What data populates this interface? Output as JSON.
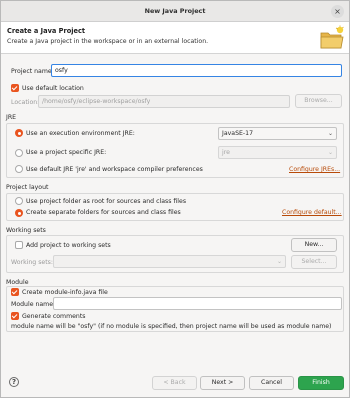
{
  "window": {
    "title": "New Java Project",
    "close_glyph": "×"
  },
  "banner": {
    "heading": "Create a Java Project",
    "description": "Create a Java project in the workspace or in an external location."
  },
  "project": {
    "name_label": "Project name:",
    "name_value": "osfy"
  },
  "location": {
    "use_default_label": "Use default location",
    "use_default_checked": true,
    "label": "Location:",
    "value": "/home/osfy/eclipse-workspace/osfy",
    "browse_label": "Browse..."
  },
  "jre": {
    "title": "JRE",
    "exec_env_label": "Use an execution environment JRE:",
    "exec_env_value": "JavaSE-17",
    "specific_label": "Use a project specific JRE:",
    "specific_value": "jre",
    "default_label": "Use default JRE 'jre' and workspace compiler preferences",
    "configure_link": "Configure JREs...",
    "selected": "exec_env"
  },
  "layout": {
    "title": "Project layout",
    "root_label": "Use project folder as root for sources and class files",
    "separate_label": "Create separate folders for sources and class files",
    "configure_link": "Configure default...",
    "selected": "separate"
  },
  "working_sets": {
    "title": "Working sets",
    "add_label": "Add project to working sets",
    "new_button": "New...",
    "sets_label": "Working sets:",
    "select_button": "Select..."
  },
  "module": {
    "title": "Module",
    "create_label": "Create module-info.java file",
    "name_label": "Module name:",
    "name_value": "",
    "comments_label": "Generate comments",
    "note": "module name will be \"osfy\"  (if no module is specified, then project name will be used as module name)"
  },
  "footer": {
    "help_glyph": "?",
    "back": "< Back",
    "next": "Next >",
    "cancel": "Cancel",
    "finish": "Finish"
  },
  "colors": {
    "accent": "#e9541f",
    "link": "#b84a08",
    "finish": "#2da44e",
    "focus": "#3584e4"
  },
  "icons": [
    "close-icon",
    "new-java-project-folder-icon",
    "chevron-down-icon",
    "help-icon"
  ]
}
